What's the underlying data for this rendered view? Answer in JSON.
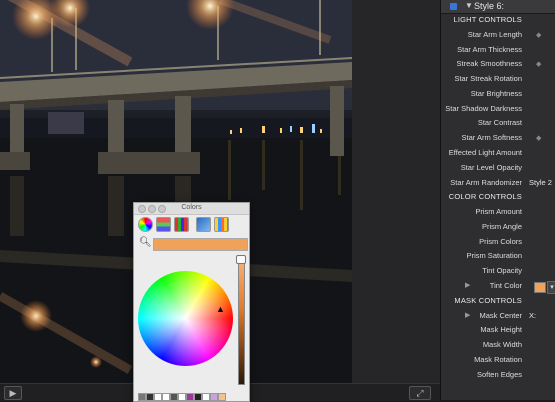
{
  "inspector": {
    "header": "Style 6:",
    "rows": [
      {
        "label": "LIGHT CONTROLS",
        "type": "section"
      },
      {
        "label": "Star Arm Length",
        "type": "param",
        "mark": true
      },
      {
        "label": "Star Arm Thickness",
        "type": "param"
      },
      {
        "label": "Streak Smoothness",
        "type": "param",
        "mark": true
      },
      {
        "label": "Star Streak Rotation",
        "type": "param"
      },
      {
        "label": "Star Brightness",
        "type": "param"
      },
      {
        "label": "Star Shadow Darkness",
        "type": "param"
      },
      {
        "label": "Star Contrast",
        "type": "param"
      },
      {
        "label": "Star Arm Softness",
        "type": "param",
        "mark": true
      },
      {
        "label": "Effected Light Amount",
        "type": "param"
      },
      {
        "label": "Star Level Opacity",
        "type": "param"
      },
      {
        "label": "Star Arm Randomizer",
        "type": "param",
        "value": "Style 2"
      },
      {
        "label": "COLOR CONTROLS",
        "type": "section"
      },
      {
        "label": "Prism Amount",
        "type": "param"
      },
      {
        "label": "Prism Angle",
        "type": "param"
      },
      {
        "label": "Prism Colors",
        "type": "param"
      },
      {
        "label": "Prism Saturation",
        "type": "param"
      },
      {
        "label": "Tint Opacity",
        "type": "param"
      },
      {
        "label": "Tint Color",
        "type": "color",
        "disclosure": true
      },
      {
        "label": "MASK CONTROLS",
        "type": "section"
      },
      {
        "label": "Mask Center",
        "type": "param",
        "value": "X:",
        "disclosure": true
      },
      {
        "label": "Mask Height",
        "type": "param"
      },
      {
        "label": "Mask Width",
        "type": "param"
      },
      {
        "label": "Mask Rotation",
        "type": "param"
      },
      {
        "label": "Soften Edges",
        "type": "param"
      }
    ]
  },
  "colors_panel": {
    "title": "Colors",
    "current_color": "#f0a15a",
    "tools": [
      "color-wheel",
      "color-sliders",
      "color-palettes",
      "image-palettes",
      "crayons"
    ]
  },
  "colors": {
    "accent": "#3a76d8",
    "tint": "#f0a15a"
  }
}
